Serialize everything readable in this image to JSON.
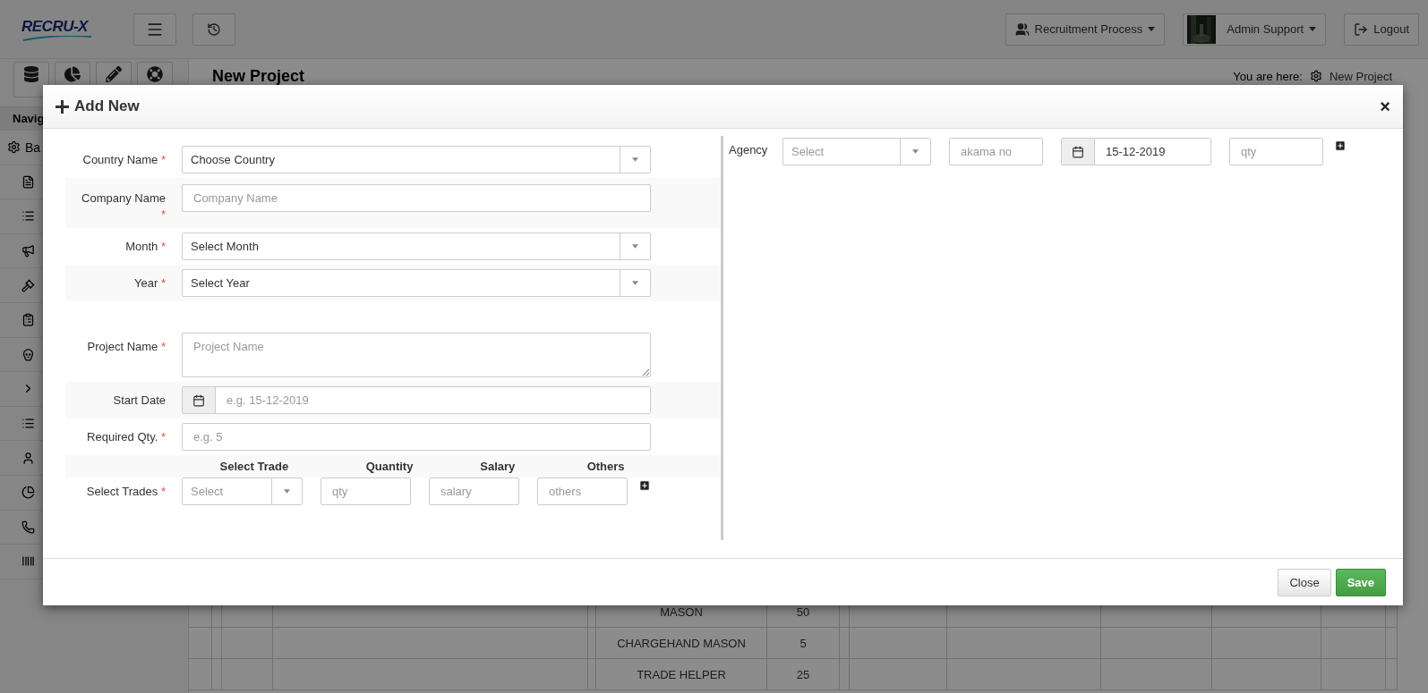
{
  "topbar": {
    "logo": "RECRU-X",
    "menus": [
      {
        "kind": "users",
        "label": "Recruitment Process"
      },
      {
        "kind": "avatar",
        "label": "Admin Support"
      }
    ],
    "logout": "Logout"
  },
  "sidebar": {
    "heading": "Navig",
    "first_item": "Ba"
  },
  "page": {
    "title": "New Project",
    "breadcrumb_prefix": "You are here:",
    "breadcrumb_current": "New Project"
  },
  "background_table": {
    "rows": [
      [
        "MASON",
        "50"
      ],
      [
        "CHARGEHAND MASON",
        "5"
      ],
      [
        "TRADE HELPER",
        "25"
      ]
    ]
  },
  "modal": {
    "title": "Add New",
    "close": "×",
    "required_mark": "*",
    "fields": [
      {
        "kind": "select",
        "label": "Country Name",
        "required": true,
        "value": "Choose Country"
      },
      {
        "kind": "text",
        "label": "Company Name",
        "required": true,
        "placeholder": "Company Name"
      },
      {
        "kind": "select",
        "label": "Month",
        "required": true,
        "value": "Select Month"
      },
      {
        "kind": "select",
        "label": "Year",
        "required": true,
        "value": "Select Year"
      },
      {
        "kind": "textarea",
        "label": "Project Name",
        "required": true,
        "placeholder": "Project Name"
      },
      {
        "kind": "date",
        "label": "Start Date",
        "required": false,
        "placeholder": "e.g. 15-12-2019"
      },
      {
        "kind": "text",
        "label": "Required Qty.",
        "required": true,
        "placeholder": "e.g. 5"
      }
    ],
    "trades": {
      "label": "Select Trades",
      "required": true,
      "columns": [
        "Select Trade",
        "Quantity",
        "Salary",
        "Others"
      ],
      "trade_placeholder": "Select",
      "qty_placeholder": "qty",
      "salary_placeholder": "salary",
      "others_placeholder": "others"
    },
    "agency": {
      "label": "Agency",
      "agency_placeholder": "Select",
      "akama_placeholder": "akama no",
      "date_value": "15-12-2019",
      "qty_placeholder": "qty"
    },
    "buttons": [
      {
        "kind": "default",
        "label": "Close"
      },
      {
        "kind": "primary",
        "label": "Save"
      }
    ]
  }
}
